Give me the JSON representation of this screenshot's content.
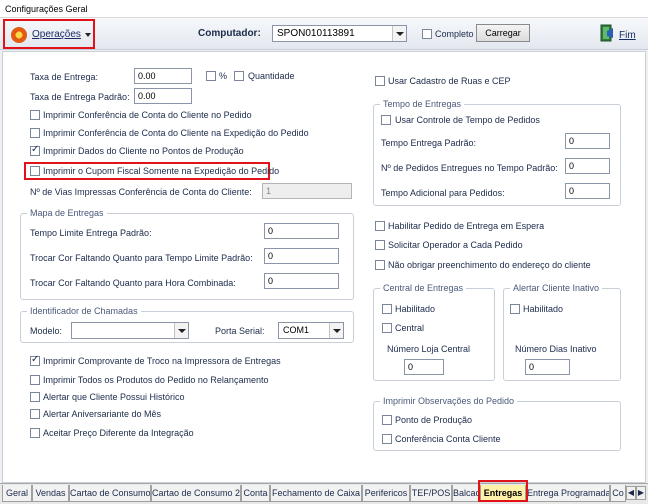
{
  "window": {
    "title": "Configurações Geral"
  },
  "toolbar": {
    "operations_label": "Operações",
    "computer_label": "Computador:",
    "computer_value": "SPON010113891",
    "complete_label": "Completo",
    "load_button": "Carregar",
    "exit_label": "Fim"
  },
  "left": {
    "delivery_fee_label": "Taxa de Entrega:",
    "delivery_fee_value": "0.00",
    "percent_label": "%",
    "quantity_label": "Quantidade",
    "default_fee_label": "Taxa de Entrega Padrão:",
    "default_fee_value": "0.00",
    "checks": [
      {
        "label": "Imprimir Conferência de Conta do Cliente no Pedido",
        "checked": false
      },
      {
        "label": "Imprimir Conferência de Conta do Cliente na Expedição do Pedido",
        "checked": false
      },
      {
        "label": "Imprimir Dados do Cliente no Pontos de Produção",
        "checked": true
      },
      {
        "label": "Imprimir o Cupom Fiscal Somente na Expedição do Pedido",
        "checked": false
      }
    ],
    "copies_label": "Nº de Vias Impressas Conferência de Conta do Cliente:",
    "copies_value": "1"
  },
  "map_group": {
    "title": "Mapa de Entregas",
    "rows": [
      {
        "label": "Tempo Limite Entrega Padrão:",
        "value": "0"
      },
      {
        "label": "Trocar Cor Faltando Quanto para Tempo Limite Padrão:",
        "value": "0"
      },
      {
        "label": "Trocar Cor Faltando Quanto para Hora Combinada:",
        "value": "0"
      }
    ]
  },
  "caller_group": {
    "title": "Identificador de Chamadas",
    "model_label": "Modelo:",
    "model_value": "",
    "port_label": "Porta Serial:",
    "port_value": "COM1"
  },
  "bottom_checks": [
    {
      "label": "Imprimir Comprovante de Troco na Impressora de Entregas",
      "checked": true
    },
    {
      "label": "Imprimir Todos os Produtos do Pedido no Relançamento",
      "checked": false
    },
    {
      "label": "Alertar que Cliente Possui Histórico",
      "checked": false
    },
    {
      "label": "Alertar Aniversariante do Mês",
      "checked": false
    },
    {
      "label": "Aceitar Preço Diferente da Integração",
      "checked": false
    }
  ],
  "right": {
    "streets_check": "Usar Cadastro de Ruas e CEP",
    "time_group": {
      "title": "Tempo de Entregas",
      "use_control": "Usar Controle de Tempo de Pedidos",
      "rows": [
        {
          "label": "Tempo Entrega Padrão:",
          "value": "0"
        },
        {
          "label": "Nº de Pedidos Entregues no Tempo Padrão:",
          "value": "0"
        },
        {
          "label": "Tempo Adicional para Pedidos:",
          "value": "0"
        }
      ]
    },
    "checks": [
      {
        "label": "Habilitar Pedido de Entrega em Espera",
        "checked": false
      },
      {
        "label": "Solicitar Operador a Cada Pedido",
        "checked": false
      },
      {
        "label": "Não obrigar preenchimento do endereço do cliente",
        "checked": false
      }
    ],
    "central_group": {
      "title": "Central de Entregas",
      "enabled": "Habilitado",
      "central": "Central",
      "store_number_label": "Número Loja Central",
      "store_number_value": "0"
    },
    "inactive_group": {
      "title": "Alertar Cliente Inativo",
      "enabled": "Habilitado",
      "days_label": "Número Dias Inativo",
      "days_value": "0"
    },
    "obs_group": {
      "title": "Imprimir Observações do Pedido",
      "items": [
        "Ponto de Produção",
        "Conferência Conta Cliente"
      ]
    }
  },
  "tabs": [
    "Geral",
    "Vendas",
    "Cartao de Consumo",
    "Cartao de Consumo 2",
    "Conta",
    "Fechamento de Caixa",
    "Perifericos",
    "TEF/POS",
    "Balcao",
    "Entregas",
    "Entrega Programada",
    "Co"
  ],
  "active_tab": "Entregas",
  "colors": {
    "highlight": "#e2121b",
    "active_tab": "#fff1a8"
  },
  "icons": [
    "gear-icon",
    "exit-door-icon",
    "dropdown-arrow-icon",
    "tab-scroll-left-icon",
    "tab-scroll-right-icon"
  ]
}
